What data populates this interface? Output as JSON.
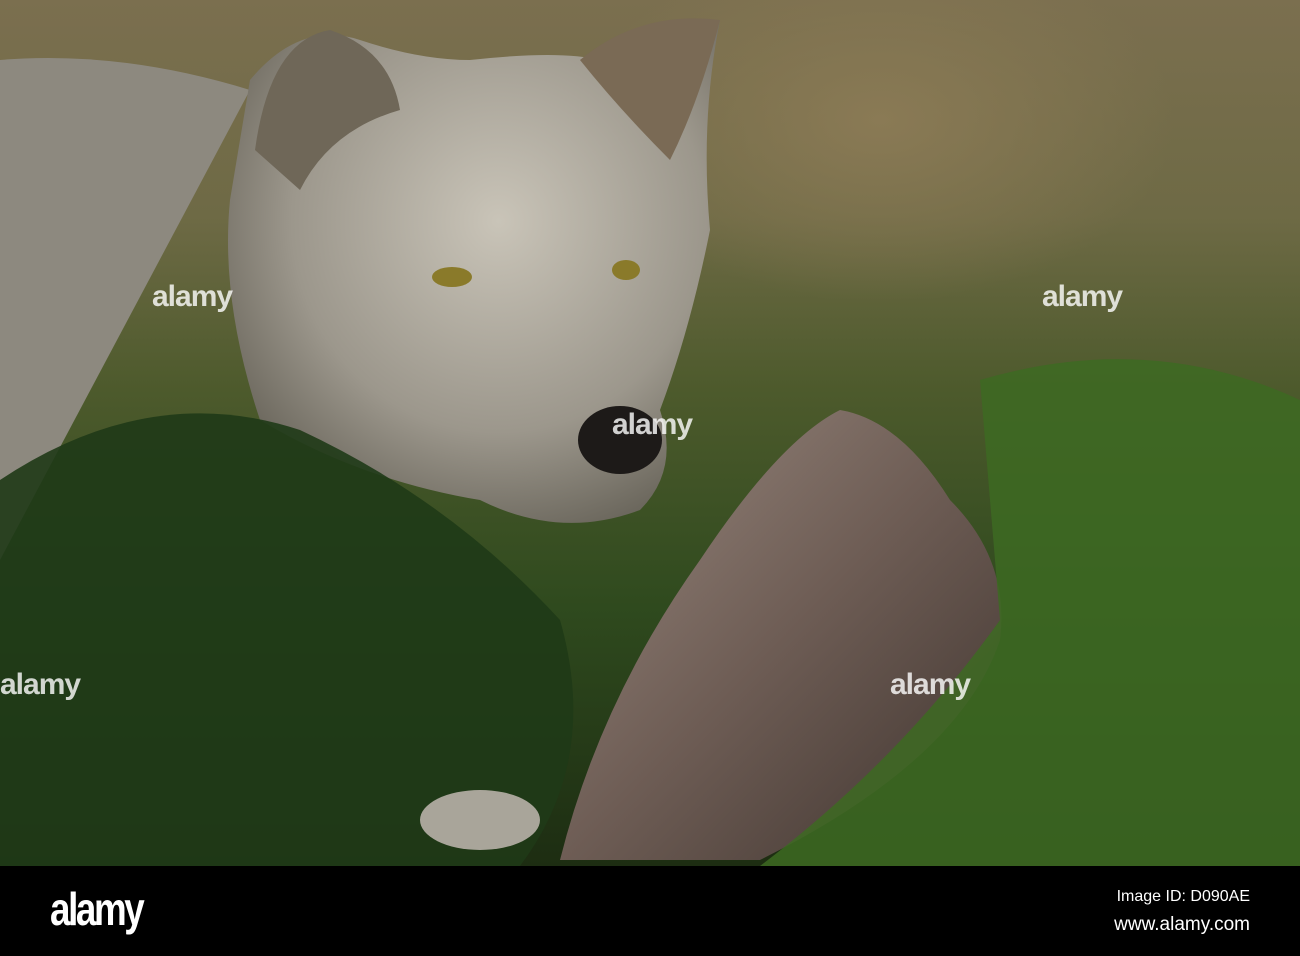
{
  "watermark": {
    "text": "alamy"
  },
  "footer": {
    "logo": "alamy",
    "image_id": "Image ID: D090AE",
    "website": "www.alamy.com"
  }
}
